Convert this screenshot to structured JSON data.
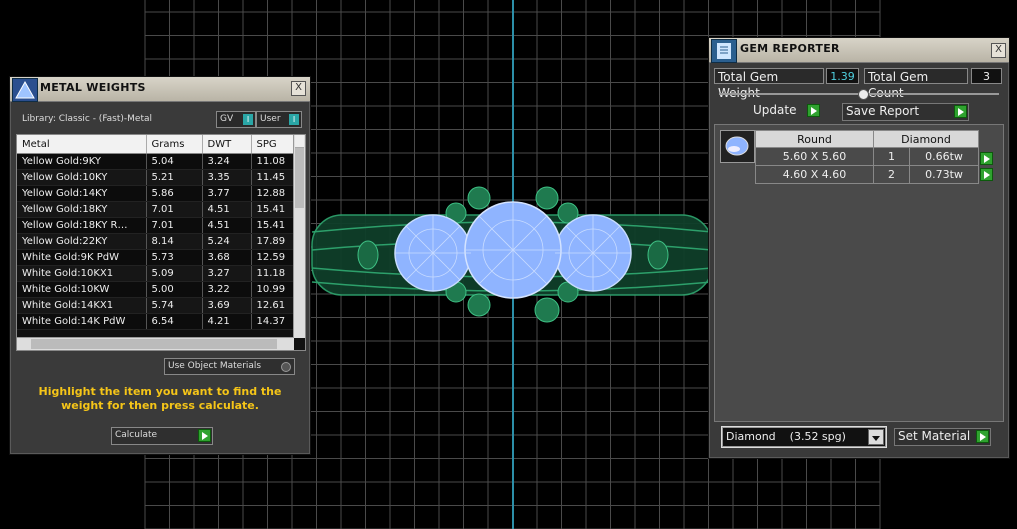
{
  "metal_weights": {
    "title": "METAL WEIGHTS",
    "close": "X",
    "library_label": "Library: Classic - (Fast)-Metal",
    "gv_label": "GV",
    "user_label": "User",
    "toggle_mark": "I",
    "columns": [
      "Metal",
      "Grams",
      "DWT",
      "SPG"
    ],
    "rows": [
      [
        "Yellow Gold:9KY",
        "5.04",
        "3.24",
        "11.08"
      ],
      [
        "Yellow Gold:10KY",
        "5.21",
        "3.35",
        "11.45"
      ],
      [
        "Yellow Gold:14KY",
        "5.86",
        "3.77",
        "12.88"
      ],
      [
        "Yellow Gold:18KY",
        "7.01",
        "4.51",
        "15.41"
      ],
      [
        "Yellow Gold:18KY R…",
        "7.01",
        "4.51",
        "15.41"
      ],
      [
        "Yellow Gold:22KY",
        "8.14",
        "5.24",
        "17.89"
      ],
      [
        "White Gold:9K PdW",
        "5.73",
        "3.68",
        "12.59"
      ],
      [
        "White Gold:10KX1",
        "5.09",
        "3.27",
        "11.18"
      ],
      [
        "White Gold:10KW",
        "5.00",
        "3.22",
        "10.99"
      ],
      [
        "White Gold:14KX1",
        "5.74",
        "3.69",
        "12.61"
      ],
      [
        "White Gold:14K PdW",
        "6.54",
        "4.21",
        "14.37"
      ]
    ],
    "use_object_materials": "Use Object Materials",
    "instruction": "Highlight the item you want to find the weight for then press calculate.",
    "calculate_label": "Calculate"
  },
  "gem_reporter": {
    "title": "GEM REPORTER",
    "close": "X",
    "total_weight_label": "Total Gem Weight",
    "total_weight_value": "1.39",
    "total_count_label": "Total Gem Count",
    "total_count_value": "3",
    "update_label": "Update",
    "save_report_label": "Save Report",
    "group_header": {
      "shape": "Round",
      "material": "Diamond"
    },
    "gems": [
      {
        "size": "5.60 X 5.60",
        "count": "1",
        "weight": "0.66tw"
      },
      {
        "size": "4.60 X 4.60",
        "count": "2",
        "weight": "0.73tw"
      }
    ],
    "material_select": "Diamond    (3.52 spg)",
    "set_material_label": "Set Material"
  },
  "colors": {
    "accent_yellow": "#f5c518",
    "go_green": "#2fa22f",
    "toggle_teal": "#2aa6a6",
    "grid_line": "#555555",
    "model_blue": "#8fb4ff",
    "model_green": "#1f7a4f"
  }
}
